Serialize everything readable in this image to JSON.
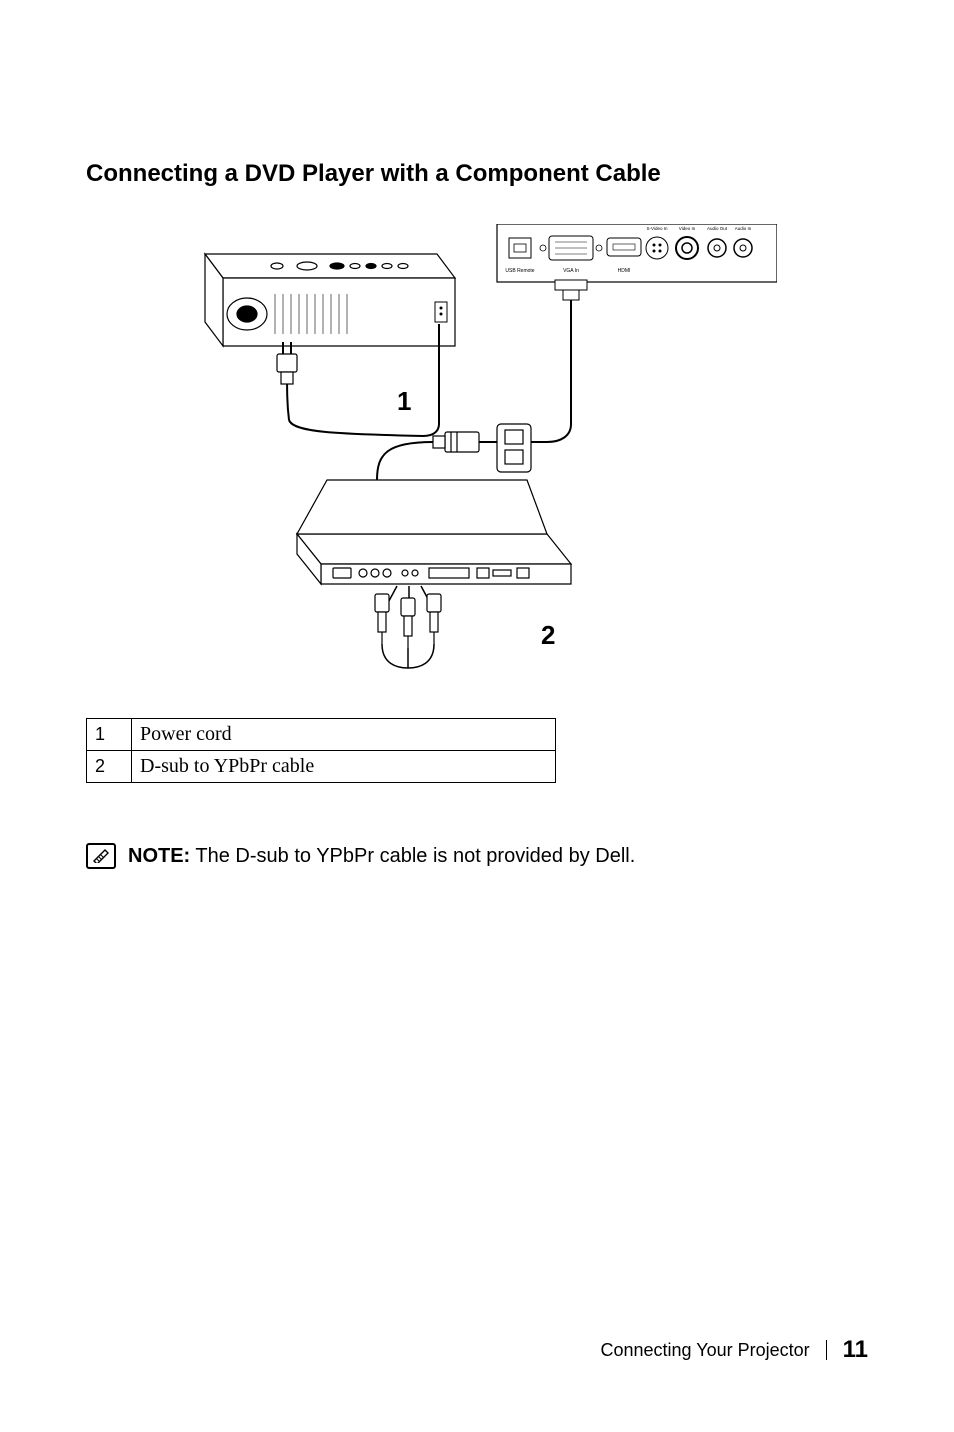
{
  "heading": "Connecting a DVD Player with a Component Cable",
  "figure": {
    "callouts": {
      "one": "1",
      "two": "2"
    },
    "ports": {
      "usb_remote": "USB Remote",
      "vga_in": "VGA In",
      "hdmi": "HDMI",
      "s_video": "S-Video In",
      "video_in": "Video In",
      "audio_out": "Audio Out",
      "audio_in": "Audio In"
    }
  },
  "legend": [
    {
      "num": "1",
      "text": "Power cord"
    },
    {
      "num": "2",
      "text": "D-sub to YPbPr cable"
    }
  ],
  "note": {
    "label": "NOTE:",
    "text": " The D-sub to YPbPr cable is not provided by Dell."
  },
  "footer": {
    "section": "Connecting Your Projector",
    "page": "11"
  }
}
